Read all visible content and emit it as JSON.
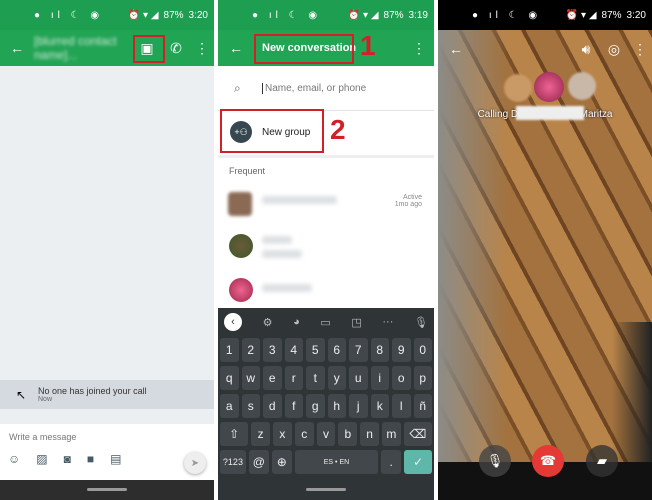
{
  "panel1": {
    "status": {
      "battery": "87%",
      "time": "3:20"
    },
    "header": {
      "title": "[blurred contact name]..."
    },
    "notification": {
      "text": "No one has joined your call",
      "time": "Now"
    },
    "compose": {
      "placeholder": "Write a message"
    }
  },
  "panel2": {
    "status": {
      "battery": "87%",
      "time": "3:19"
    },
    "header": {
      "title": "New conversation"
    },
    "step1": "1",
    "step2": "2",
    "search": {
      "placeholder": "Name, email, or phone"
    },
    "new_group": "New group",
    "section": "Frequent",
    "contacts": [
      {
        "status": "Active",
        "time": "1mo ago"
      },
      {},
      {}
    ],
    "keyboard": {
      "rows": [
        [
          "1",
          "2",
          "3",
          "4",
          "5",
          "6",
          "7",
          "8",
          "9",
          "0"
        ],
        [
          "q",
          "w",
          "e",
          "r",
          "t",
          "y",
          "u",
          "i",
          "o",
          "p"
        ],
        [
          "a",
          "s",
          "d",
          "f",
          "g",
          "h",
          "j",
          "k",
          "l",
          "ñ"
        ],
        [
          "⇧",
          "z",
          "x",
          "c",
          "v",
          "b",
          "n",
          "m",
          "⌫"
        ]
      ],
      "symbols": "?123",
      "at": "@",
      "space": "ES • EN"
    }
  },
  "panel3": {
    "status": {
      "battery": "87%",
      "time": "3:20"
    },
    "calling_text": "Calling Del                 , Judy, and Maritza"
  },
  "colors": {
    "green": "#22a455",
    "highlight": "#d32027",
    "end_call": "#e53935",
    "key": "#41474b"
  }
}
